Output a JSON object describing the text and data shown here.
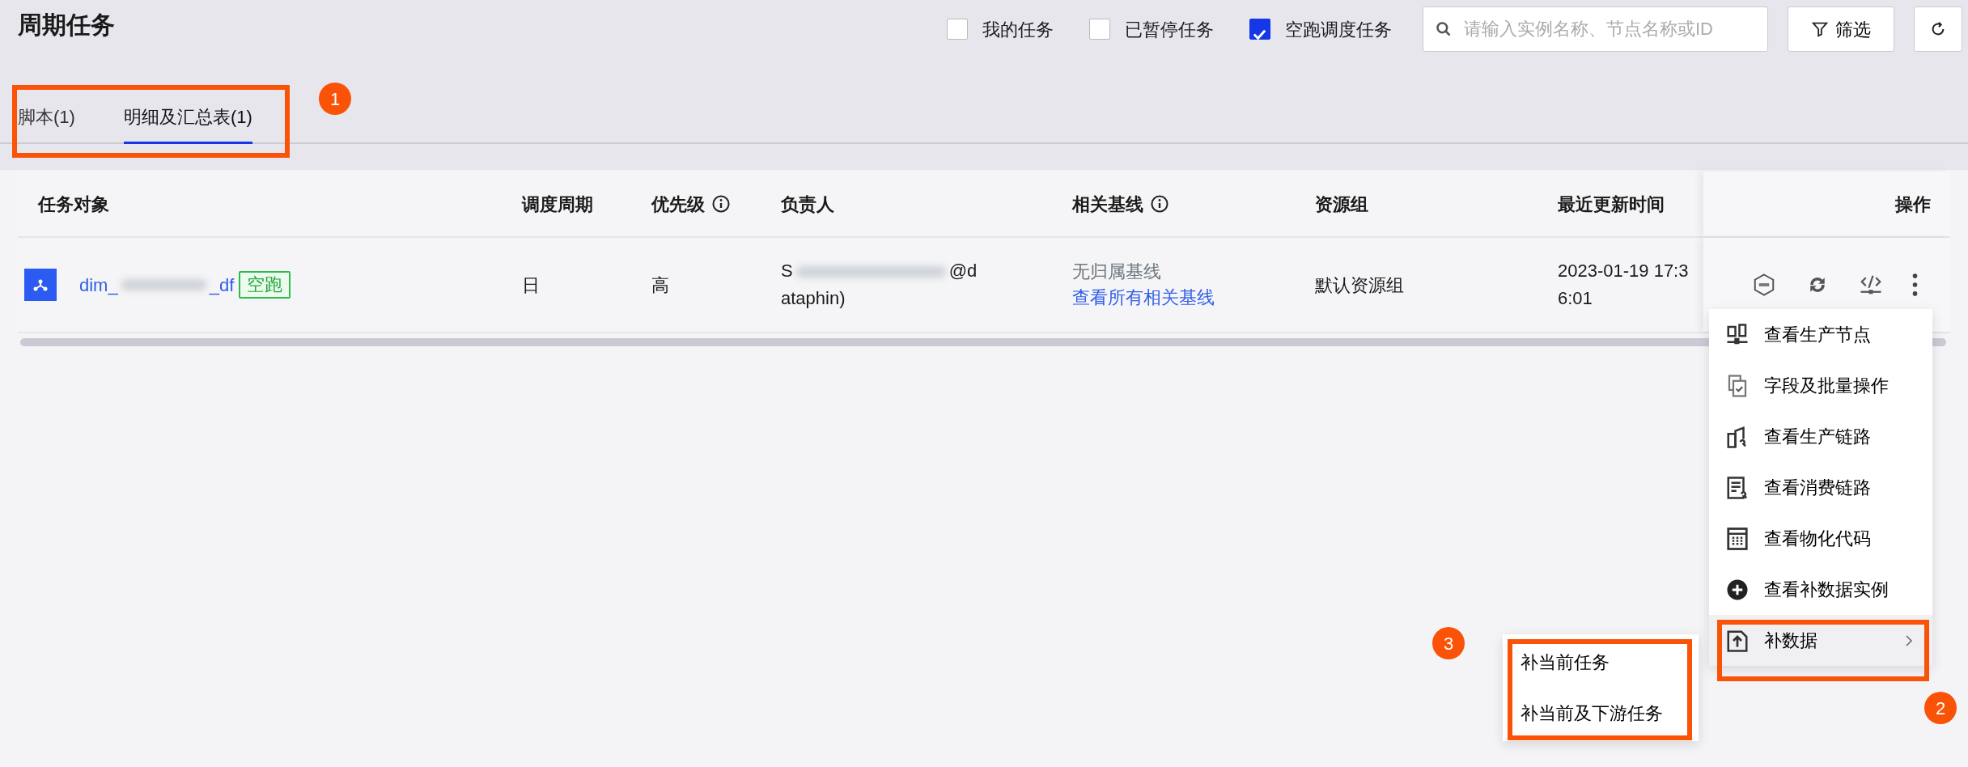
{
  "title": "周期任务",
  "filters": [
    {
      "label": "我的任务",
      "checked": false
    },
    {
      "label": "已暂停任务",
      "checked": false
    },
    {
      "label": "空跑调度任务",
      "checked": true
    }
  ],
  "search": {
    "placeholder": "请输入实例名称、节点名称或ID"
  },
  "filter_button": "筛选",
  "tabs": [
    {
      "label": "脚本(1)",
      "selected": false
    },
    {
      "label": "明细及汇总表(1)",
      "selected": true
    }
  ],
  "table": {
    "columns": [
      {
        "label": "任务对象",
        "info": false
      },
      {
        "label": "调度周期",
        "info": false
      },
      {
        "label": "优先级",
        "info": true
      },
      {
        "label": "负责人",
        "info": false
      },
      {
        "label": "相关基线",
        "info": true
      },
      {
        "label": "资源组",
        "info": false
      },
      {
        "label": "最近更新时间",
        "info": false
      },
      {
        "label": "操作",
        "info": false
      }
    ],
    "rows": [
      {
        "name_start": "dim_",
        "name_end": "_df",
        "tag": "空跑",
        "cycle": "日",
        "priority": "高",
        "owner_start": "S",
        "owner_end": "@dataphin)",
        "baseline": "无归属基线",
        "baseline_link": "查看所有相关基线",
        "resource_group": "默认资源组",
        "updated": "2023-01-19 17:36:01"
      }
    ]
  },
  "menu": {
    "items": [
      {
        "kind": "nodes",
        "label": "查看生产节点",
        "highlighted": false,
        "submenu": false
      },
      {
        "kind": "fields",
        "label": "字段及批量操作",
        "highlighted": false,
        "submenu": false
      },
      {
        "kind": "lineage",
        "label": "查看生产链路",
        "highlighted": false,
        "submenu": false
      },
      {
        "kind": "consume",
        "label": "查看消费链路",
        "highlighted": false,
        "submenu": false
      },
      {
        "kind": "code",
        "label": "查看物化代码",
        "highlighted": false,
        "submenu": false
      },
      {
        "kind": "instances",
        "label": "查看补数据实例",
        "highlighted": false,
        "submenu": false
      },
      {
        "kind": "backfill",
        "label": "补数据",
        "highlighted": true,
        "submenu": true
      }
    ]
  },
  "submenu": {
    "items": [
      "补当前任务",
      "补当前及下游任务"
    ]
  },
  "callouts": [
    "1",
    "2",
    "3"
  ]
}
